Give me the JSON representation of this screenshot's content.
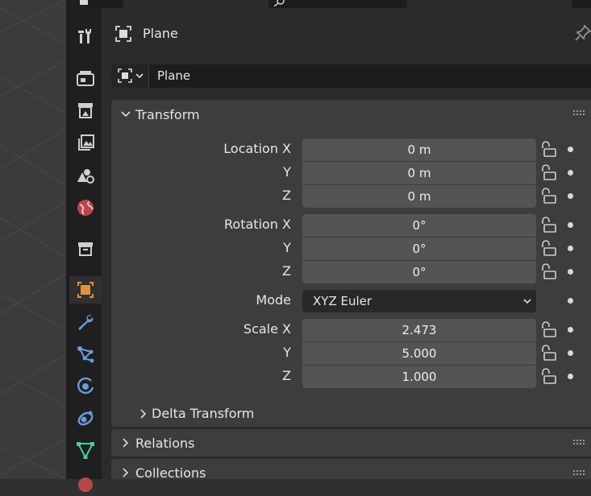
{
  "context": {
    "object_name": "Plane"
  },
  "name_field": {
    "value": "Plane"
  },
  "transform": {
    "title": "Transform",
    "location": {
      "label_x": "Location X",
      "label_y": "Y",
      "label_z": "Z",
      "x": "0 m",
      "y": "0 m",
      "z": "0 m"
    },
    "rotation": {
      "label_x": "Rotation X",
      "label_y": "Y",
      "label_z": "Z",
      "x": "0°",
      "y": "0°",
      "z": "0°"
    },
    "mode": {
      "label": "Mode",
      "value": "XYZ Euler"
    },
    "scale": {
      "label_x": "Scale X",
      "label_y": "Y",
      "label_z": "Z",
      "x": "2.473",
      "y": "5.000",
      "z": "1.000"
    },
    "delta_title": "Delta Transform"
  },
  "relations": {
    "title": "Relations"
  },
  "collections": {
    "title": "Collections"
  },
  "colors": {
    "accent_orange": "#e0913f",
    "modifier_blue": "#6c9bd8",
    "constraint_teal": "#4ec99a"
  }
}
